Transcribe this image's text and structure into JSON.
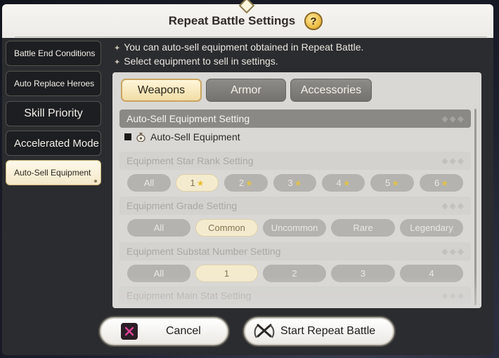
{
  "header": {
    "title": "Repeat Battle Settings",
    "help_label": "?"
  },
  "sidebar": {
    "items": [
      {
        "label": "Battle End Conditions",
        "active": false
      },
      {
        "label": "Auto Replace Heroes",
        "active": false
      },
      {
        "label": "Skill Priority",
        "active": false
      },
      {
        "label": "Accelerated Mode",
        "active": false
      },
      {
        "label": "Auto-Sell Equipment",
        "active": true
      }
    ]
  },
  "info": {
    "line1": "You can auto-sell equipment obtained in Repeat Battle.",
    "line2": "Select equipment to sell in settings."
  },
  "tabs": [
    {
      "label": "Weapons",
      "active": true
    },
    {
      "label": "Armor",
      "active": false
    },
    {
      "label": "Accessories",
      "active": false
    }
  ],
  "autosell": {
    "header": "Auto-Sell Equipment Setting",
    "checkbox_label": "Auto-Sell Equipment",
    "checked": true
  },
  "star_rank": {
    "header": "Equipment Star Rank Setting",
    "options": [
      "All",
      "1",
      "2",
      "3",
      "4",
      "5",
      "6"
    ],
    "selected": "1"
  },
  "grade": {
    "header": "Equipment Grade Setting",
    "options": [
      "All",
      "Common",
      "Uncommon",
      "Rare",
      "Legendary"
    ],
    "selected": "Common"
  },
  "substat": {
    "header": "Equipment Substat Number Setting",
    "options": [
      "All",
      "1",
      "2",
      "3",
      "4"
    ],
    "selected": "1"
  },
  "mainstat": {
    "header": "Equipment Main Stat Setting"
  },
  "buttons": {
    "cancel": "Cancel",
    "start": "Start Repeat Battle"
  },
  "colors": {
    "accent_gold": "#f1dda5",
    "panel": "#2b2c2f",
    "content_bg": "#d9d8d5"
  },
  "icons": {
    "help": "question-mark",
    "cancel": "x-mark",
    "start": "crossed-swords",
    "bag": "money-bag",
    "star": "star"
  }
}
